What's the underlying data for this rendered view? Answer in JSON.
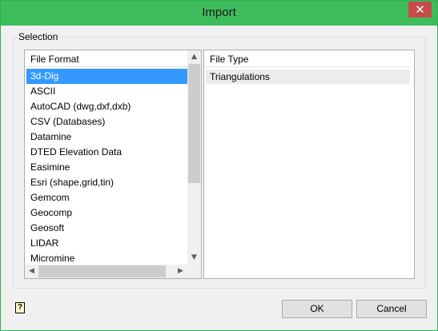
{
  "window": {
    "title": "Import",
    "close_glyph": "✕"
  },
  "group": {
    "label": "Selection"
  },
  "left_list": {
    "header": "File Format",
    "items": [
      "3d-Dig",
      "ASCII",
      "AutoCAD (dwg,dxf,dxb)",
      "CSV (Databases)",
      "Datamine",
      "DTED Elevation Data",
      "Easimine",
      "Esri (shape,grid,tin)",
      "Gemcom",
      "Geocomp",
      "Geosoft",
      "LIDAR",
      "Micromine"
    ],
    "selected": "3d-Dig"
  },
  "right_list": {
    "header": "File Type",
    "items": [
      "Triangulations"
    ]
  },
  "buttons": {
    "ok": "OK",
    "cancel": "Cancel"
  },
  "icons": {
    "help": "help-icon",
    "scroll_up": "▲",
    "scroll_down": "▼",
    "scroll_left": "◀",
    "scroll_right": "▶"
  },
  "colors": {
    "titlebar": "#3dbc5c",
    "selection": "#3399ff",
    "close": "#c74b4b"
  }
}
